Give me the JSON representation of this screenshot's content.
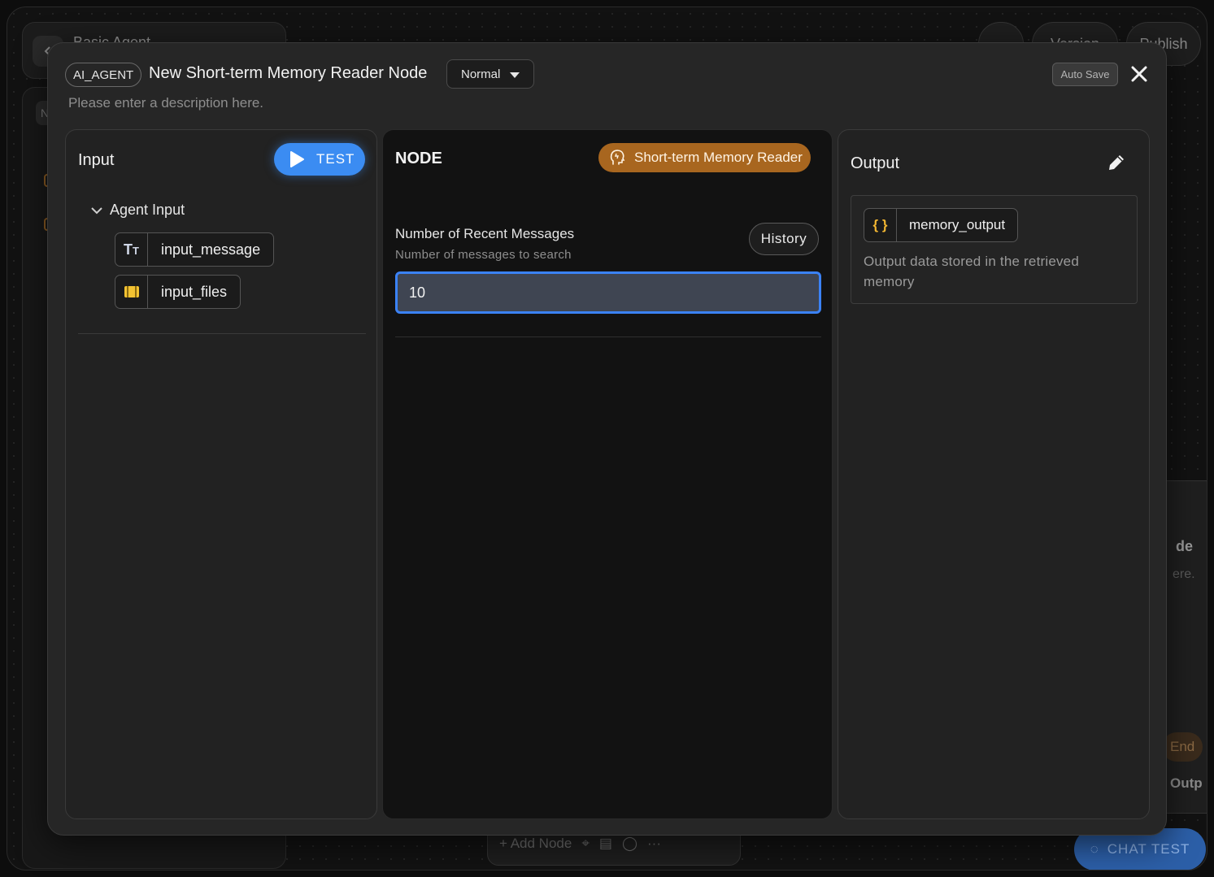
{
  "background": {
    "app_title": "Basic Agent",
    "side_tab": "No",
    "more_label": "···",
    "version_label": "Version",
    "publish_label": "Publish",
    "node_title_partial": "de",
    "node_desc_partial": "ere.",
    "end_label": "End",
    "output_partial": "Outp",
    "add_node_label": "+ Add Node",
    "chat_test_label": "CHAT TEST"
  },
  "modal": {
    "type_badge": "AI_AGENT",
    "title": "New Short-term Memory Reader Node",
    "mode": "Normal",
    "description_placeholder": "Please enter a description here.",
    "auto_save_label": "Auto Save",
    "close_icon": "close-icon"
  },
  "input_panel": {
    "title": "Input",
    "test_label": "TEST",
    "group_label": "Agent Input",
    "variables": [
      {
        "name": "input_message",
        "icon": "text-type-icon"
      },
      {
        "name": "input_files",
        "icon": "files-icon"
      }
    ]
  },
  "node_panel": {
    "title": "NODE",
    "node_type": "Short-term Memory Reader",
    "field_label": "Number of Recent Messages",
    "field_hint": "Number of messages to search",
    "history_label": "History",
    "field_value": "10"
  },
  "output_panel": {
    "title": "Output",
    "output_name": "memory_output",
    "output_icon_glyph": "{ }",
    "output_description": "Output data stored in the retrieved memory"
  },
  "colors": {
    "accent_blue": "#3b8cf2",
    "node_badge": "#a8661f",
    "files_icon": "#f2c232"
  }
}
